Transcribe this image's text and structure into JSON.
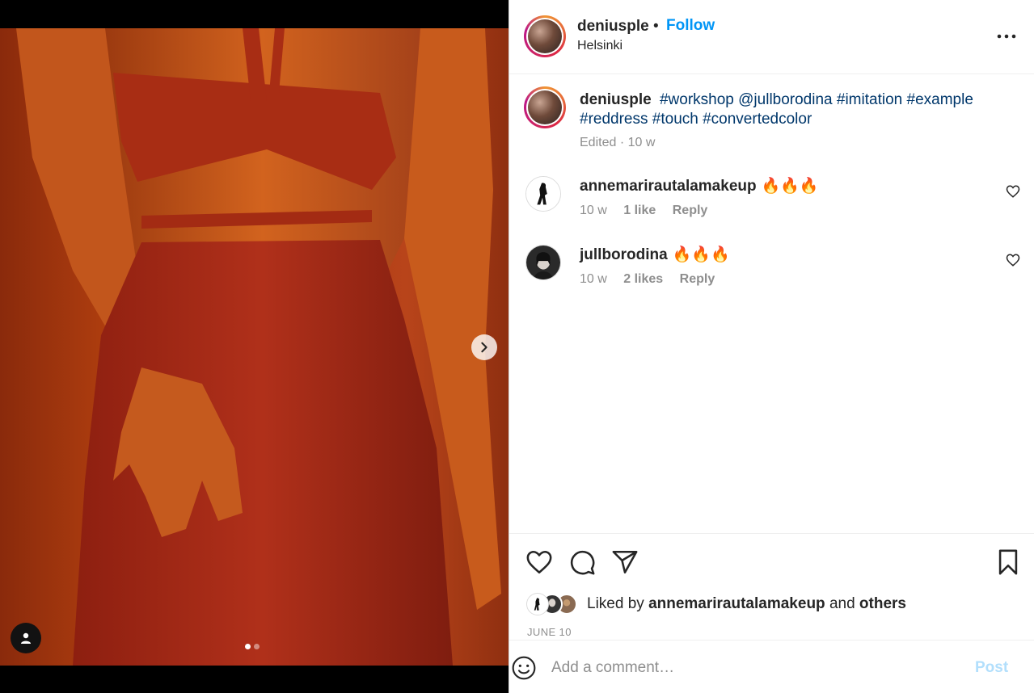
{
  "post": {
    "username": "deniusple",
    "separator": "•",
    "follow_label": "Follow",
    "location": "Helsinki",
    "caption_user": "deniusple",
    "caption_tags": [
      "#workshop",
      "@jullborodina",
      "#imitation",
      "#example",
      "#reddress",
      "#touch",
      "#convertedcolor"
    ],
    "caption_meta": "Edited · 10 w"
  },
  "comments": [
    {
      "user": "annemarirautalamakeup",
      "text": "🔥🔥🔥",
      "age": "10 w",
      "likes": "1 like",
      "reply": "Reply"
    },
    {
      "user": "jullborodina",
      "text": "🔥🔥🔥",
      "age": "10 w",
      "likes": "2 likes",
      "reply": "Reply"
    }
  ],
  "likes": {
    "prefix": "Liked by",
    "user": "annemarirautalamakeup",
    "middle": "and",
    "others": "others"
  },
  "date": "JUNE 10",
  "composer": {
    "placeholder": "Add a comment…",
    "post_label": "Post"
  },
  "carousel": {
    "count": 2,
    "active": 0
  },
  "colors": {
    "accent": "#0095f6",
    "tag": "#00376b",
    "muted": "#8e8e8e",
    "post_disabled": "#b2dffc"
  },
  "icons": [
    "next-arrow-icon",
    "tag-people-icon",
    "more-options-icon",
    "heart-icon",
    "comment-icon",
    "share-icon",
    "bookmark-icon",
    "emoji-icon"
  ]
}
